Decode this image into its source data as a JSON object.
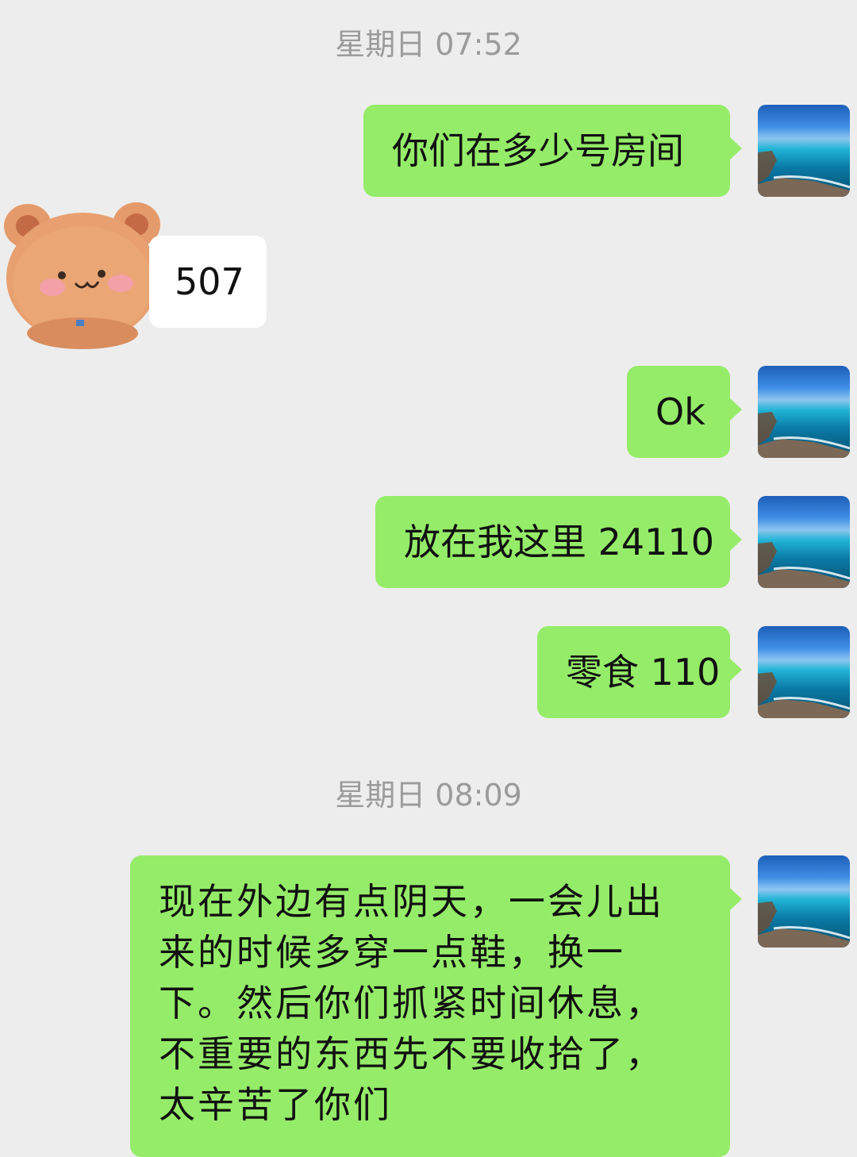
{
  "conversation": {
    "timestamps": [
      {
        "text": "星期日 07:52"
      },
      {
        "text": "星期日 08:09"
      }
    ],
    "messages": [
      {
        "sender": "me",
        "text": "你们在多少号房间"
      },
      {
        "sender": "other",
        "text": "507"
      },
      {
        "sender": "me",
        "text": "Ok"
      },
      {
        "sender": "me",
        "text": "放在我这里 24110"
      },
      {
        "sender": "me",
        "text": "零食 110"
      },
      {
        "sender": "me",
        "text": "现在外边有点阴天，一会儿出来的时候多穿一点鞋，换一下。然后你们抓紧时间休息，不重要的东西先不要收拾了，太辛苦了你们"
      }
    ]
  },
  "avatars": {
    "me": {
      "icon": "ocean-coast-photo"
    },
    "other": {
      "icon": "teddy-bear-sticker"
    }
  },
  "colors": {
    "background": "#ededed",
    "my_bubble": "#95ec69",
    "their_bubble": "#ffffff",
    "timestamp_text": "#9b9b9b"
  }
}
